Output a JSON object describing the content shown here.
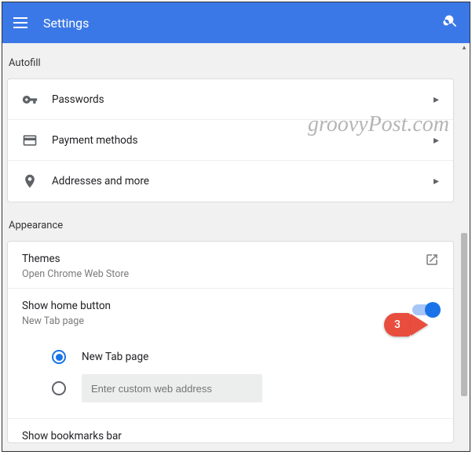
{
  "header": {
    "title": "Settings"
  },
  "autofill": {
    "label": "Autofill",
    "items": [
      {
        "label": "Passwords"
      },
      {
        "label": "Payment methods"
      },
      {
        "label": "Addresses and more"
      }
    ]
  },
  "appearance": {
    "label": "Appearance",
    "themes": {
      "title": "Themes",
      "subtitle": "Open Chrome Web Store"
    },
    "home_button": {
      "title": "Show home button",
      "subtitle": "New Tab page",
      "toggle_on": true,
      "options": {
        "new_tab_label": "New Tab page",
        "custom_placeholder": "Enter custom web address"
      }
    },
    "bookmarks_bar": {
      "title": "Show bookmarks bar"
    }
  },
  "annotation": {
    "number": "3"
  },
  "watermark": "groovyPost.com"
}
